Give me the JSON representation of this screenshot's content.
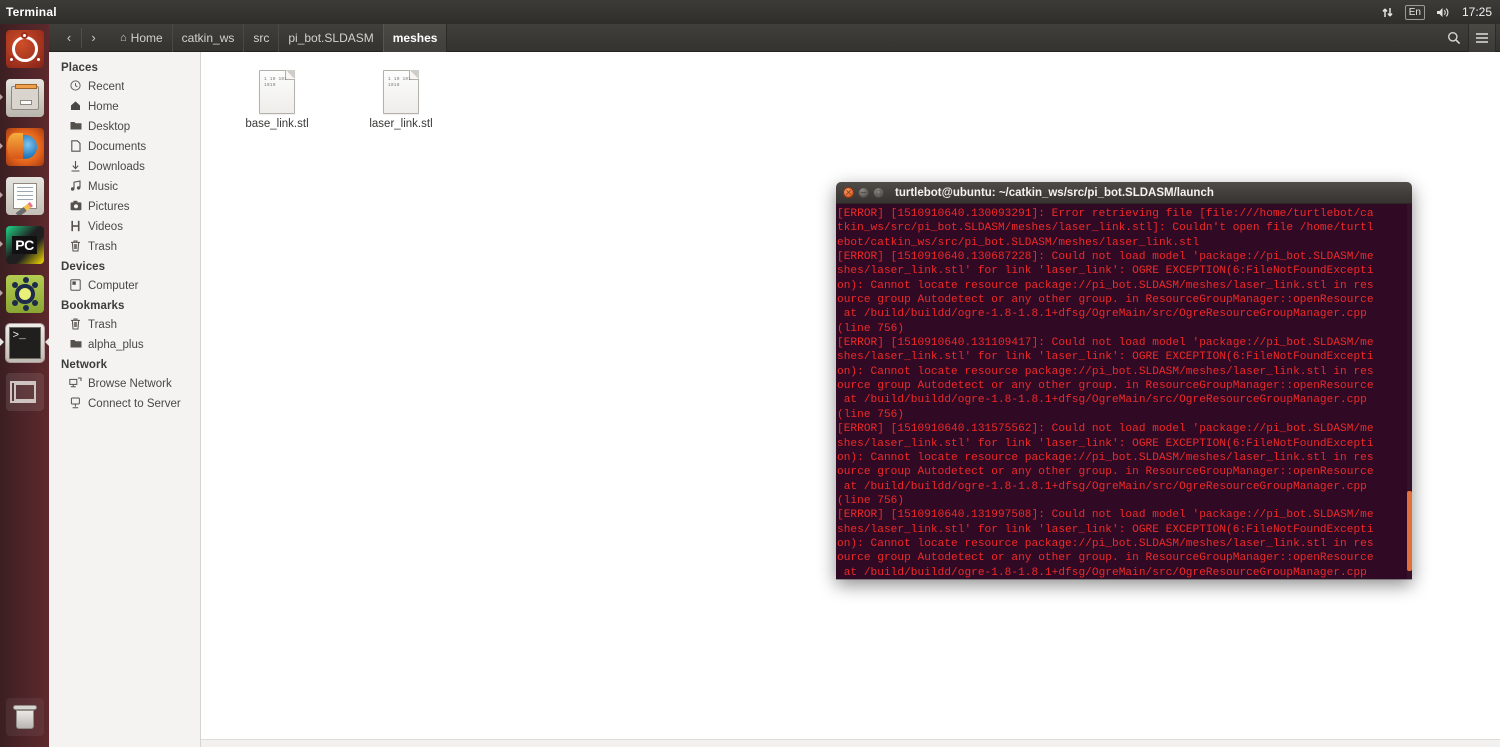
{
  "top_panel": {
    "app_title": "Terminal",
    "indicators": {
      "network_icon": "network-updown-arrows-icon",
      "keyboard_layout": "En",
      "volume_icon": "volume-speaker-icon",
      "clock": "17:25"
    }
  },
  "launcher": {
    "items": [
      {
        "name": "ubuntu-dash",
        "label": "Ubuntu Dash",
        "icon": "ubuntu-logo-icon",
        "active": false
      },
      {
        "name": "files",
        "label": "Files",
        "icon": "file-cabinet-icon",
        "active": false
      },
      {
        "name": "firefox",
        "label": "Firefox Web Browser",
        "icon": "firefox-icon",
        "active": false
      },
      {
        "name": "text-editor",
        "label": "Text Editor",
        "icon": "document-pencil-icon",
        "active": false
      },
      {
        "name": "pycharm",
        "label": "PyCharm",
        "icon": "pycharm-icon",
        "badge": "PC",
        "active": false
      },
      {
        "name": "ros",
        "label": "ROS",
        "icon": "ros-nodes-icon",
        "active": false
      },
      {
        "name": "terminal",
        "label": "Terminal",
        "icon": "terminal-icon",
        "prompt": ">_",
        "active": true
      },
      {
        "name": "workspace-switcher",
        "label": "Workspace Switcher",
        "icon": "workspace-squares-icon",
        "active": false
      }
    ],
    "trash": {
      "label": "Trash",
      "icon": "trash-can-icon"
    }
  },
  "file_manager": {
    "nav": {
      "back_icon": "chevron-left-icon",
      "forward_icon": "chevron-right-icon"
    },
    "breadcrumb": [
      {
        "label": "Home",
        "icon": "home-icon",
        "active": false
      },
      {
        "label": "catkin_ws",
        "active": false
      },
      {
        "label": "src",
        "active": false
      },
      {
        "label": "pi_bot.SLDASM",
        "active": false
      },
      {
        "label": "meshes",
        "active": true
      }
    ],
    "toolbar_right": [
      {
        "name": "search-icon",
        "glyph": "⌕"
      },
      {
        "name": "menu-icon",
        "glyph": "☰"
      }
    ],
    "sidebar": [
      {
        "type": "heading",
        "label": "Places"
      },
      {
        "type": "item",
        "label": "Recent",
        "icon": "clock-icon",
        "glyph": "🕐"
      },
      {
        "type": "item",
        "label": "Home",
        "icon": "home-icon",
        "glyph": "⌂"
      },
      {
        "type": "item",
        "label": "Desktop",
        "icon": "folder-icon",
        "glyph": "🗀"
      },
      {
        "type": "item",
        "label": "Documents",
        "icon": "document-icon",
        "glyph": "🗋"
      },
      {
        "type": "item",
        "label": "Downloads",
        "icon": "download-arrow-icon",
        "glyph": "⤓"
      },
      {
        "type": "item",
        "label": "Music",
        "icon": "music-note-icon",
        "glyph": "♫"
      },
      {
        "type": "item",
        "label": "Pictures",
        "icon": "camera-icon",
        "glyph": "▣"
      },
      {
        "type": "item",
        "label": "Videos",
        "icon": "film-strip-icon",
        "glyph": "▤"
      },
      {
        "type": "item",
        "label": "Trash",
        "icon": "trash-can-icon",
        "glyph": "🗑"
      },
      {
        "type": "heading",
        "label": "Devices"
      },
      {
        "type": "item",
        "label": "Computer",
        "icon": "computer-icon",
        "glyph": "▤"
      },
      {
        "type": "heading",
        "label": "Bookmarks"
      },
      {
        "type": "item",
        "label": "Trash",
        "icon": "trash-can-icon",
        "glyph": "🗑"
      },
      {
        "type": "item",
        "label": "alpha_plus",
        "icon": "folder-icon",
        "glyph": "🗀"
      },
      {
        "type": "heading",
        "label": "Network"
      },
      {
        "type": "item",
        "label": "Browse Network",
        "icon": "network-browse-icon",
        "glyph": "🖧"
      },
      {
        "type": "item",
        "label": "Connect to Server",
        "icon": "server-connect-icon",
        "glyph": "🖥"
      }
    ],
    "files": [
      {
        "label": "base_link.stl",
        "icon": "binary-file-icon",
        "bits": "1\n10\n101\n1010"
      },
      {
        "label": "laser_link.stl",
        "icon": "binary-file-icon",
        "bits": "1\n10\n101\n1010"
      }
    ]
  },
  "terminal": {
    "title": "turtlebot@ubuntu: ~/catkin_ws/src/pi_bot.SLDASM/launch",
    "window_buttons": [
      {
        "name": "close-button",
        "color": "#e0622a"
      },
      {
        "name": "minimize-button",
        "color": "#5e5a56"
      },
      {
        "name": "maximize-button",
        "color": "#5e5a56"
      }
    ],
    "colors": {
      "background": "#300a24",
      "error_text": "#ef2929",
      "scrollbar_thumb": "#e2703a"
    },
    "output": "[ERROR] [1510910640.130093291]: Error retrieving file [file:///home/turtlebot/ca\ntkin_ws/src/pi_bot.SLDASM/meshes/laser_link.stl]: Couldn't open file /home/turtl\nebot/catkin_ws/src/pi_bot.SLDASM/meshes/laser_link.stl\n[ERROR] [1510910640.130687228]: Could not load model 'package://pi_bot.SLDASM/me\nshes/laser_link.stl' for link 'laser_link': OGRE EXCEPTION(6:FileNotFoundExcepti\non): Cannot locate resource package://pi_bot.SLDASM/meshes/laser_link.stl in res\nource group Autodetect or any other group. in ResourceGroupManager::openResource\n at /build/buildd/ogre-1.8-1.8.1+dfsg/OgreMain/src/OgreResourceGroupManager.cpp\n(line 756)\n[ERROR] [1510910640.131109417]: Could not load model 'package://pi_bot.SLDASM/me\nshes/laser_link.stl' for link 'laser_link': OGRE EXCEPTION(6:FileNotFoundExcepti\non): Cannot locate resource package://pi_bot.SLDASM/meshes/laser_link.stl in res\nource group Autodetect or any other group. in ResourceGroupManager::openResource\n at /build/buildd/ogre-1.8-1.8.1+dfsg/OgreMain/src/OgreResourceGroupManager.cpp\n(line 756)\n[ERROR] [1510910640.131575562]: Could not load model 'package://pi_bot.SLDASM/me\nshes/laser_link.stl' for link 'laser_link': OGRE EXCEPTION(6:FileNotFoundExcepti\non): Cannot locate resource package://pi_bot.SLDASM/meshes/laser_link.stl in res\nource group Autodetect or any other group. in ResourceGroupManager::openResource\n at /build/buildd/ogre-1.8-1.8.1+dfsg/OgreMain/src/OgreResourceGroupManager.cpp\n(line 756)\n[ERROR] [1510910640.131997508]: Could not load model 'package://pi_bot.SLDASM/me\nshes/laser_link.stl' for link 'laser_link': OGRE EXCEPTION(6:FileNotFoundExcepti\non): Cannot locate resource package://pi_bot.SLDASM/meshes/laser_link.stl in res\nource group Autodetect or any other group. in ResourceGroupManager::openResource\n at /build/buildd/ogre-1.8-1.8.1+dfsg/OgreMain/src/OgreResourceGroupManager.cpp"
  }
}
